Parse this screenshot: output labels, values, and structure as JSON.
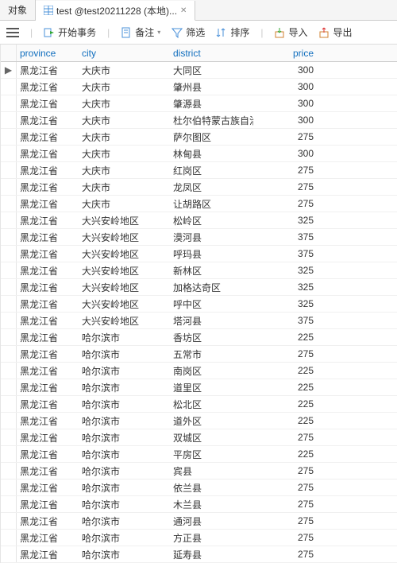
{
  "tabs": {
    "t0": "对象",
    "t1": "test @test20211228 (本地)..."
  },
  "toolbar": {
    "begin": "开始事务",
    "memo": "备注",
    "filter": "筛选",
    "sort": "排序",
    "import": "导入",
    "export": "导出"
  },
  "headers": {
    "province": "province",
    "city": "city",
    "district": "district",
    "price": "price"
  },
  "rows": [
    {
      "p": "黑龙江省",
      "c": "大庆市",
      "d": "大同区",
      "pr": "300"
    },
    {
      "p": "黑龙江省",
      "c": "大庆市",
      "d": "肇州县",
      "pr": "300"
    },
    {
      "p": "黑龙江省",
      "c": "大庆市",
      "d": "肇源县",
      "pr": "300"
    },
    {
      "p": "黑龙江省",
      "c": "大庆市",
      "d": "杜尔伯特蒙古族自治县",
      "pr": "300"
    },
    {
      "p": "黑龙江省",
      "c": "大庆市",
      "d": "萨尔图区",
      "pr": "275"
    },
    {
      "p": "黑龙江省",
      "c": "大庆市",
      "d": "林甸县",
      "pr": "300"
    },
    {
      "p": "黑龙江省",
      "c": "大庆市",
      "d": "红岗区",
      "pr": "275"
    },
    {
      "p": "黑龙江省",
      "c": "大庆市",
      "d": "龙凤区",
      "pr": "275"
    },
    {
      "p": "黑龙江省",
      "c": "大庆市",
      "d": "让胡路区",
      "pr": "275"
    },
    {
      "p": "黑龙江省",
      "c": "大兴安岭地区",
      "d": "松岭区",
      "pr": "325"
    },
    {
      "p": "黑龙江省",
      "c": "大兴安岭地区",
      "d": "漠河县",
      "pr": "375"
    },
    {
      "p": "黑龙江省",
      "c": "大兴安岭地区",
      "d": "呼玛县",
      "pr": "375"
    },
    {
      "p": "黑龙江省",
      "c": "大兴安岭地区",
      "d": "新林区",
      "pr": "325"
    },
    {
      "p": "黑龙江省",
      "c": "大兴安岭地区",
      "d": "加格达奇区",
      "pr": "325"
    },
    {
      "p": "黑龙江省",
      "c": "大兴安岭地区",
      "d": "呼中区",
      "pr": "325"
    },
    {
      "p": "黑龙江省",
      "c": "大兴安岭地区",
      "d": "塔河县",
      "pr": "375"
    },
    {
      "p": "黑龙江省",
      "c": "哈尔滨市",
      "d": "香坊区",
      "pr": "225"
    },
    {
      "p": "黑龙江省",
      "c": "哈尔滨市",
      "d": "五常市",
      "pr": "275"
    },
    {
      "p": "黑龙江省",
      "c": "哈尔滨市",
      "d": "南岗区",
      "pr": "225"
    },
    {
      "p": "黑龙江省",
      "c": "哈尔滨市",
      "d": "道里区",
      "pr": "225"
    },
    {
      "p": "黑龙江省",
      "c": "哈尔滨市",
      "d": "松北区",
      "pr": "225"
    },
    {
      "p": "黑龙江省",
      "c": "哈尔滨市",
      "d": "道外区",
      "pr": "225"
    },
    {
      "p": "黑龙江省",
      "c": "哈尔滨市",
      "d": "双城区",
      "pr": "275"
    },
    {
      "p": "黑龙江省",
      "c": "哈尔滨市",
      "d": "平房区",
      "pr": "225"
    },
    {
      "p": "黑龙江省",
      "c": "哈尔滨市",
      "d": "宾县",
      "pr": "275"
    },
    {
      "p": "黑龙江省",
      "c": "哈尔滨市",
      "d": "依兰县",
      "pr": "275"
    },
    {
      "p": "黑龙江省",
      "c": "哈尔滨市",
      "d": "木兰县",
      "pr": "275"
    },
    {
      "p": "黑龙江省",
      "c": "哈尔滨市",
      "d": "通河县",
      "pr": "275"
    },
    {
      "p": "黑龙江省",
      "c": "哈尔滨市",
      "d": "方正县",
      "pr": "275"
    },
    {
      "p": "黑龙江省",
      "c": "哈尔滨市",
      "d": "延寿县",
      "pr": "275"
    }
  ]
}
